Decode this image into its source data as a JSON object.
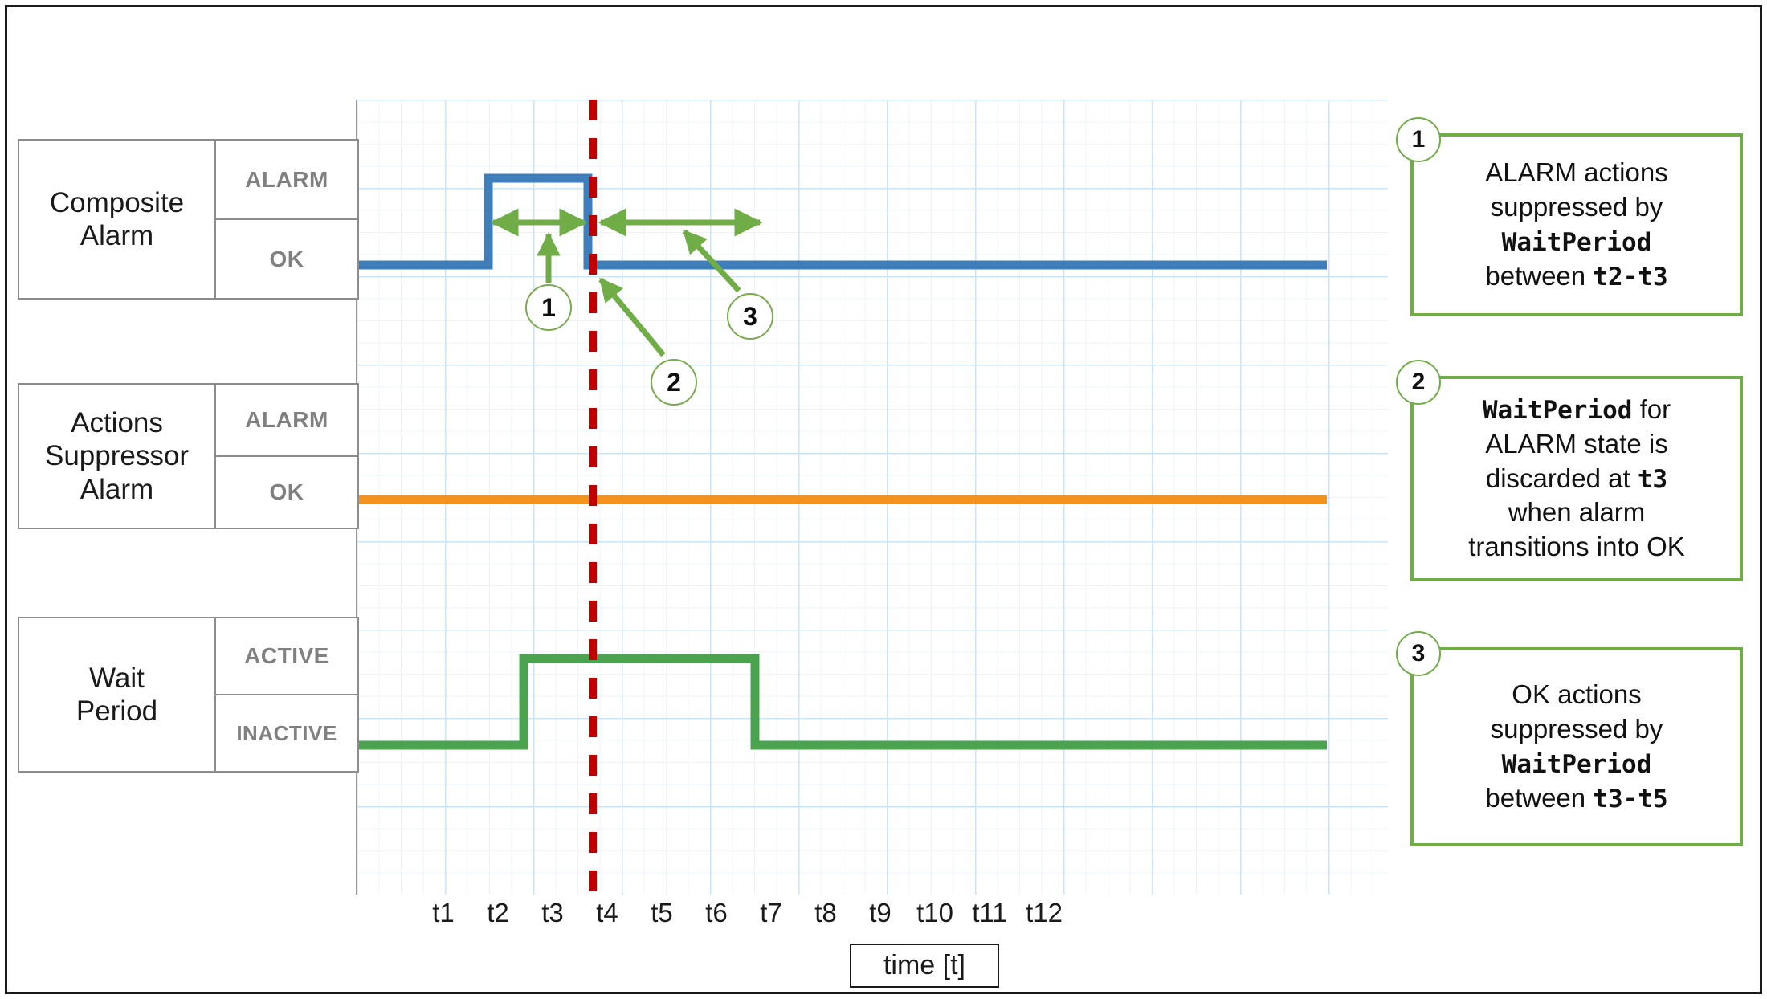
{
  "diagram": {
    "title": "Composite Alarm WaitPeriod suppression timing diagram",
    "colors": {
      "composite_alarm_line": "#3d7ebb",
      "actions_suppressor_line": "#f3931e",
      "wait_period_line": "#4ba350",
      "marker_line": "#c00000",
      "annotation_green": "#70ad47",
      "grid_major": "#cfe4f2",
      "grid_minor": "#eaf4fb",
      "box_border": "#8c8c8c",
      "state_text": "#808080"
    }
  },
  "lanes": [
    {
      "id": "composite-alarm",
      "name": "Composite\nAlarm",
      "name_line1": "Composite",
      "name_line2": "Alarm",
      "state_high": "ALARM",
      "state_low": "OK"
    },
    {
      "id": "actions-suppressor-alarm",
      "name": "Actions\nSuppressor\nAlarm",
      "name_line1": "Actions",
      "name_line2": "Suppressor",
      "name_line3": "Alarm",
      "state_high": "ALARM",
      "state_low": "OK"
    },
    {
      "id": "wait-period",
      "name": "Wait\nPeriod",
      "name_line1": "Wait",
      "name_line2": "Period",
      "state_high": "ACTIVE",
      "state_low": "INACTIVE"
    }
  ],
  "axis": {
    "caption": "time [t]",
    "ticks": [
      "t1",
      "t2",
      "t3",
      "t4",
      "t5",
      "t6",
      "t7",
      "t8",
      "t9",
      "t10",
      "t11",
      "t12"
    ]
  },
  "markers": [
    {
      "id": "marker-1",
      "label": "1"
    },
    {
      "id": "marker-2",
      "label": "2"
    },
    {
      "id": "marker-3",
      "label": "3"
    }
  ],
  "callouts": [
    {
      "id": "callout-1",
      "badge": "1",
      "line1": "ALARM actions",
      "line2": "suppressed by",
      "mono1": "WaitPeriod",
      "line3_pre": "between ",
      "mono2": "t2-t3"
    },
    {
      "id": "callout-2",
      "badge": "2",
      "mono1": "WaitPeriod",
      "line1_post": " for",
      "line2": "ALARM state is",
      "line3_pre": "discarded at ",
      "mono2": "t3",
      "line4": "when alarm",
      "line5": "transitions into OK"
    },
    {
      "id": "callout-3",
      "badge": "3",
      "line1": "OK actions",
      "line2": "suppressed by",
      "mono1": "WaitPeriod",
      "line3_pre": "between ",
      "mono2": "t3-t5"
    }
  ],
  "chart_data": {
    "type": "line",
    "title": "Composite Alarm WaitPeriod suppression timeline",
    "xlabel": "time [t]",
    "ylabel": "",
    "grid": true,
    "legend": "none",
    "x": [
      "t1",
      "t2",
      "t3",
      "t4",
      "t5",
      "t6",
      "t7",
      "t8",
      "t9",
      "t10",
      "t11",
      "t12"
    ],
    "xlim": [
      "t0",
      "t12.5"
    ],
    "series": [
      {
        "name": "Composite Alarm",
        "color": "#3d7ebb",
        "states": [
          "OK",
          "ALARM"
        ],
        "steps": [
          {
            "from": "t0",
            "to": "t2",
            "state": "OK"
          },
          {
            "from": "t2",
            "to": "t3",
            "state": "ALARM"
          },
          {
            "from": "t3",
            "to": "t12",
            "state": "OK"
          }
        ]
      },
      {
        "name": "Actions Suppressor Alarm",
        "color": "#f3931e",
        "states": [
          "OK",
          "ALARM"
        ],
        "steps": [
          {
            "from": "t0",
            "to": "t12",
            "state": "OK"
          }
        ]
      },
      {
        "name": "Wait Period",
        "color": "#4ba350",
        "states": [
          "INACTIVE",
          "ACTIVE"
        ],
        "steps": [
          {
            "from": "t0",
            "to": "t2",
            "state": "INACTIVE"
          },
          {
            "from": "t2",
            "to": "t5",
            "state": "ACTIVE"
          },
          {
            "from": "t5",
            "to": "t12",
            "state": "INACTIVE"
          }
        ]
      }
    ],
    "annotations": [
      {
        "type": "vline",
        "at": "t3",
        "style": "dashed",
        "color": "#c00000"
      },
      {
        "type": "span-arrow",
        "from": "t2",
        "to": "t3",
        "marker": "1",
        "note": "ALARM actions suppressed by WaitPeriod between t2-t3"
      },
      {
        "type": "point",
        "at": "t3",
        "marker": "2",
        "note": "WaitPeriod for ALARM state is discarded at t3 when alarm transitions into OK"
      },
      {
        "type": "span-arrow",
        "from": "t3",
        "to": "t5",
        "marker": "3",
        "note": "OK actions suppressed by WaitPeriod between t3-t5"
      }
    ]
  }
}
